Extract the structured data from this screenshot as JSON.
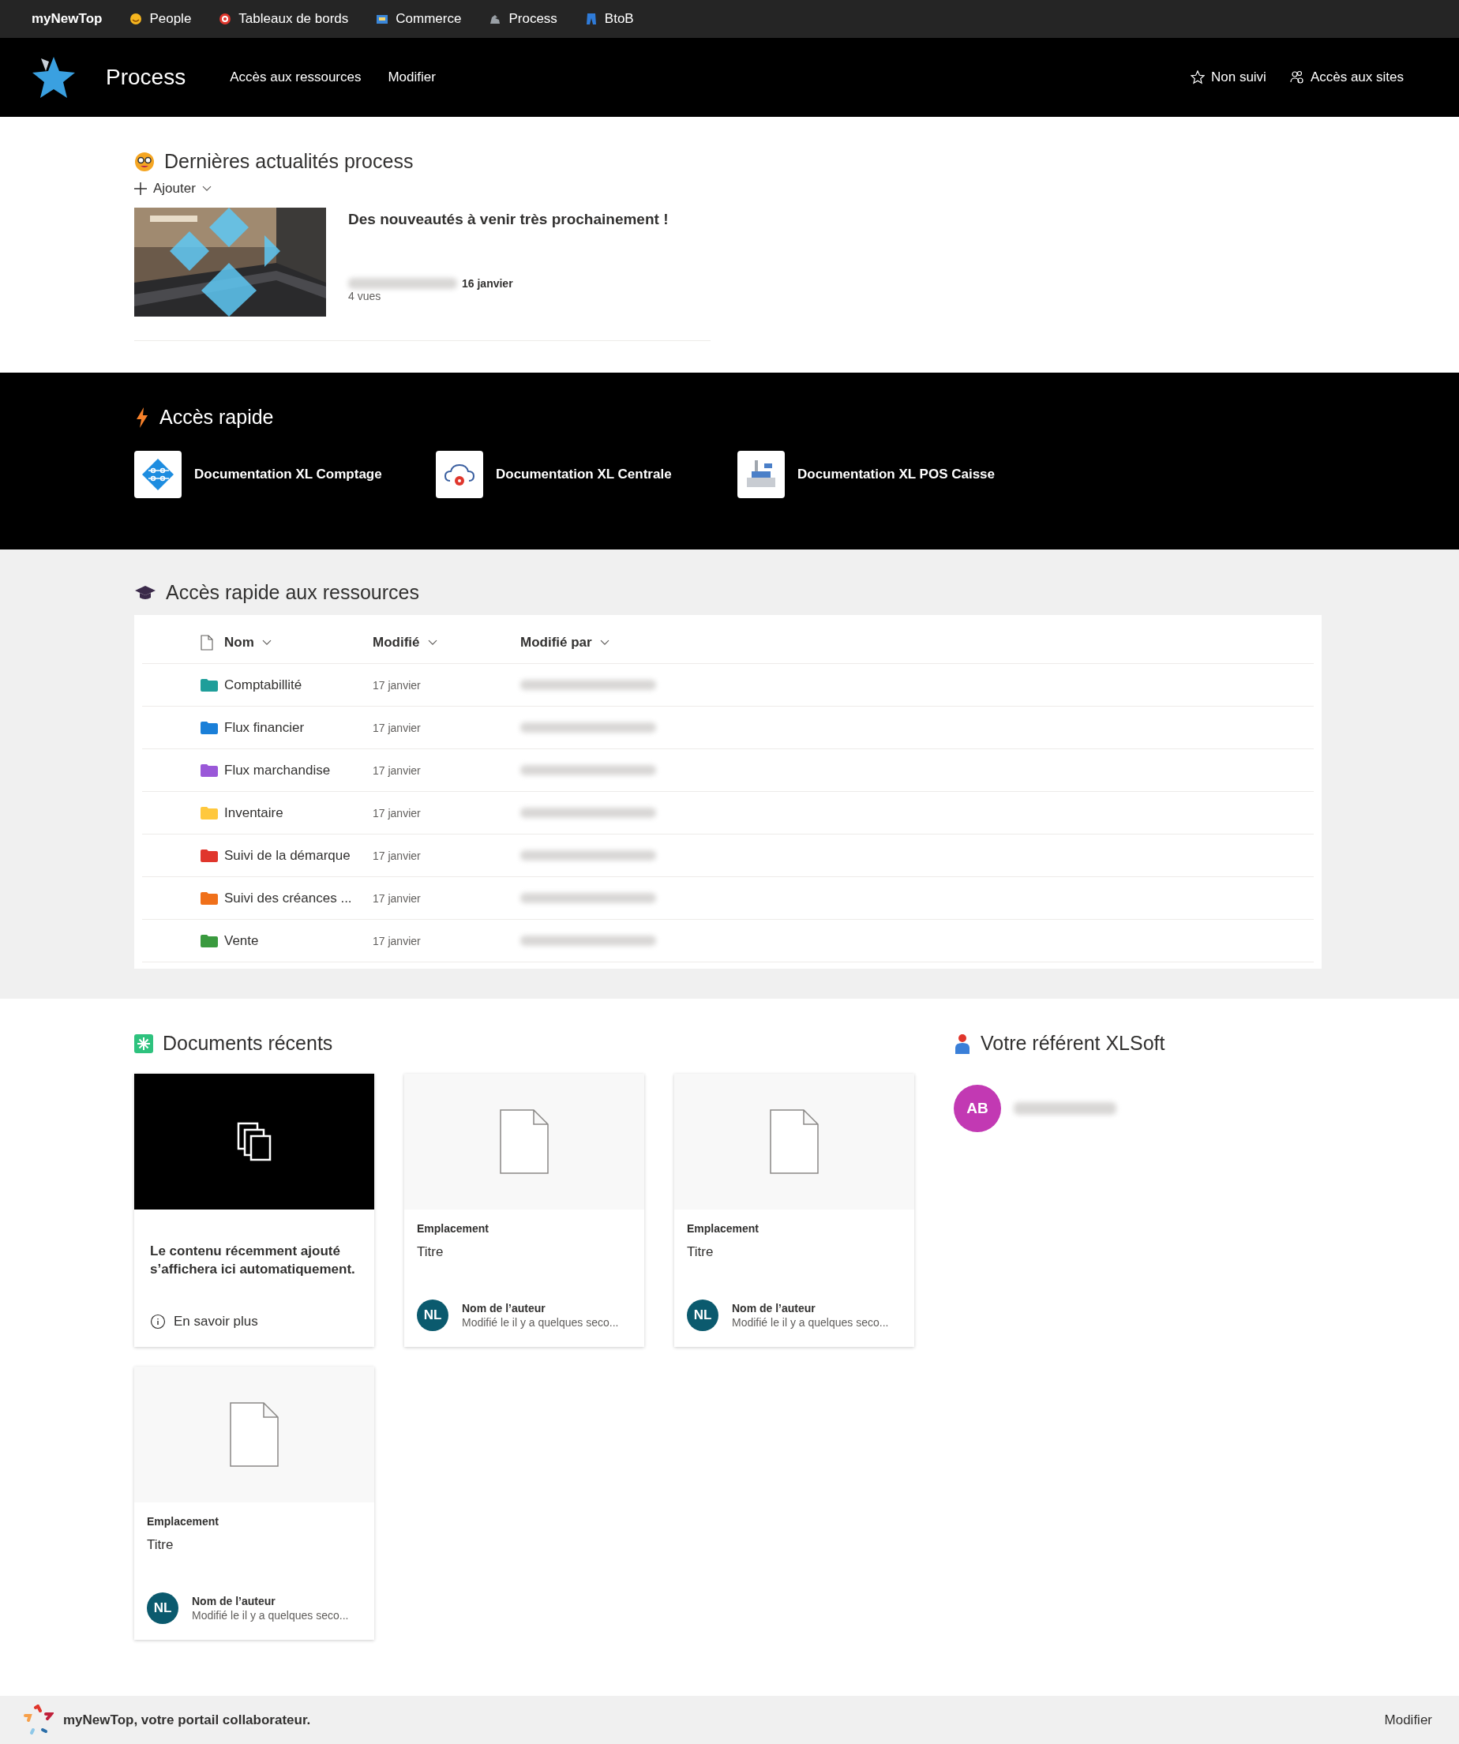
{
  "top_nav": {
    "brand": "myNewTop",
    "items": [
      "People",
      "Tableaux de bords",
      "Commerce",
      "Process",
      "BtoB"
    ]
  },
  "site_header": {
    "title": "Process",
    "links": [
      "Accès aux ressources",
      "Modifier"
    ],
    "actions": [
      "Non suivi",
      "Accès aux sites"
    ]
  },
  "news": {
    "title": "Dernières actualités process",
    "add_label": "Ajouter",
    "articles": [
      {
        "title": "Des nouveautés à venir très prochainement !",
        "date": "16 janvier",
        "views": "4 vues"
      }
    ]
  },
  "quick_links": {
    "title": "Accès rapide",
    "items": [
      "Documentation XL Comptage",
      "Documentation XL Centrale",
      "Documentation XL POS Caisse"
    ]
  },
  "resources": {
    "title": "Accès rapide aux ressources",
    "columns": [
      "Nom",
      "Modifié",
      "Modifié par"
    ],
    "rows": [
      {
        "name": "Comptabillité",
        "modified": "17 janvier",
        "color": "#1f9e9a"
      },
      {
        "name": "Flux financier",
        "modified": "17 janvier",
        "color": "#1a7fd8"
      },
      {
        "name": "Flux marchandise",
        "modified": "17 janvier",
        "color": "#9a58d8"
      },
      {
        "name": "Inventaire",
        "modified": "17 janvier",
        "color": "#ffc83d"
      },
      {
        "name": "Suivi de la démarque",
        "modified": "17 janvier",
        "color": "#e0362c"
      },
      {
        "name": "Suivi des créances ...",
        "modified": "17 janvier",
        "color": "#f0701a"
      },
      {
        "name": "Vente",
        "modified": "17 janvier",
        "color": "#3a9a3f"
      }
    ]
  },
  "recent_documents": {
    "title": "Documents récents",
    "cards": [
      {
        "kind": "placeholder",
        "message": "Le contenu récemment ajouté s’affichera ici automatiquement.",
        "link": "En savoir plus"
      },
      {
        "kind": "document",
        "location": "Emplacement",
        "title": "Titre",
        "initials": "NL",
        "author": "Nom de l’auteur",
        "modified": "Modifié le il y a quelques seco..."
      },
      {
        "kind": "document",
        "location": "Emplacement",
        "title": "Titre",
        "initials": "NL",
        "author": "Nom de l’auteur",
        "modified": "Modifié le il y a quelques seco..."
      },
      {
        "kind": "document",
        "location": "Emplacement",
        "title": "Titre",
        "initials": "NL",
        "author": "Nom de l’auteur",
        "modified": "Modifié le il y a quelques seco..."
      }
    ]
  },
  "referent": {
    "title": "Votre référent XLSoft",
    "initials": "AB"
  },
  "footer": {
    "text": "myNewTop, votre portail collaborateur.",
    "action": "Modifier"
  }
}
